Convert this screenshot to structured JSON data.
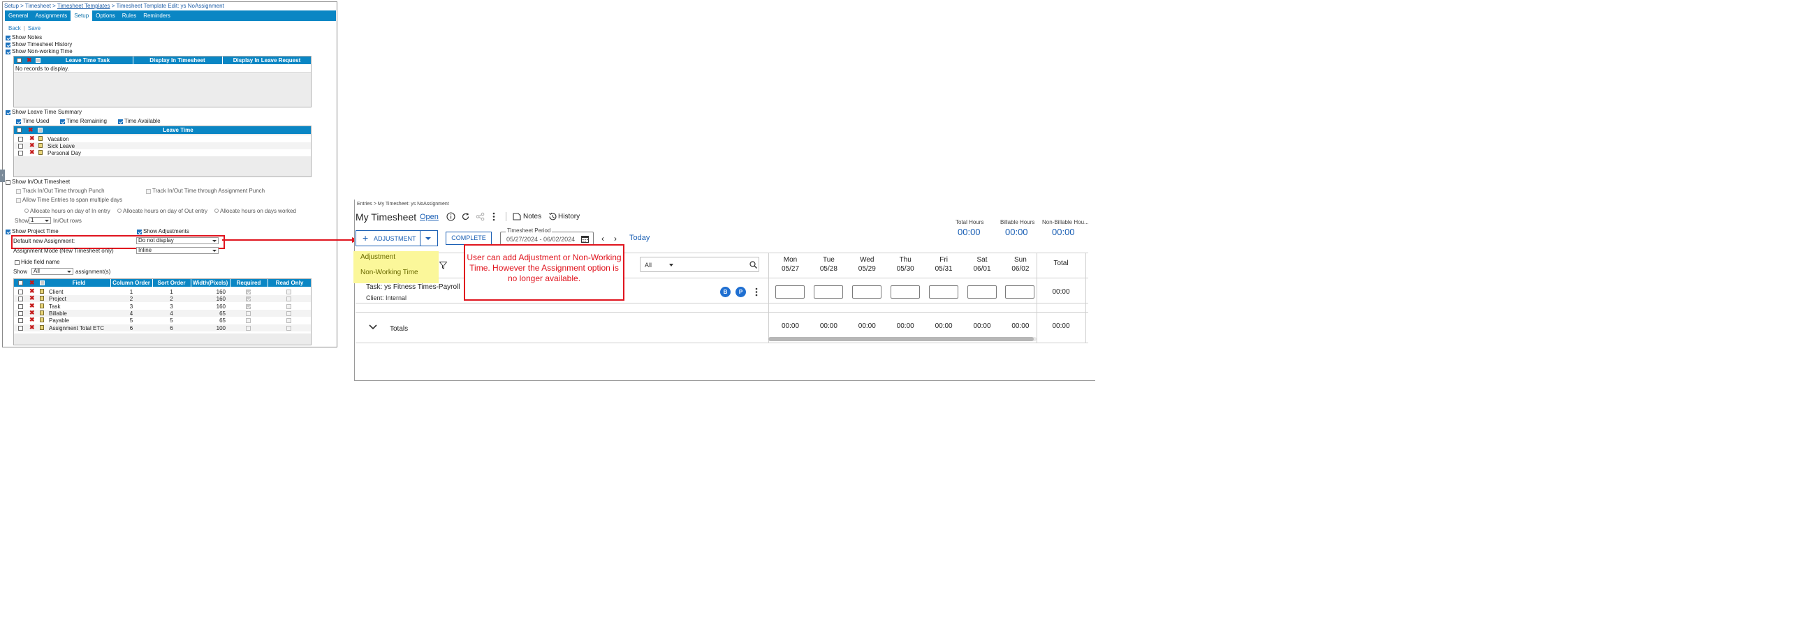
{
  "left": {
    "breadcrumb": {
      "p1": "Setup > Timesheet > ",
      "p2": "Timesheet Templates",
      "p3": " > Timesheet Template Edit: ys NoAssignment"
    },
    "tabs": [
      "General",
      "Assignments",
      "Setup",
      "Options",
      "Rules",
      "Reminders"
    ],
    "active_tab": "Setup",
    "back": "Back",
    "save": "Save",
    "show_notes": "Show Notes",
    "show_timesheet_history": "Show Timesheet History",
    "show_nonworking_time": "Show Non-working Time",
    "leave_grid": {
      "col1": "Leave Time Task",
      "col2": "Display In Timesheet",
      "col3": "Display In Leave Request",
      "empty": "No records to display."
    },
    "show_leave_summary": "Show Leave Time Summary",
    "time_used": "Time Used",
    "time_remaining": "Time Remaining",
    "time_available": "Time Available",
    "leave_time_grid": {
      "header": "Leave Time",
      "rows": [
        "Vacation",
        "Sick Leave",
        "Personal Day"
      ]
    },
    "show_inout": "Show In/Out Timesheet",
    "track_punch": "Track In/Out Time through Punch",
    "track_assignment_punch": "Track In/Out Time through Assignment Punch",
    "allow_span": "Allow Time Entries to span multiple days",
    "alloc_in": "Allocate hours on day of In entry",
    "alloc_out": "Allocate hours on day of Out entry",
    "alloc_worked": "Allocate hours on days worked",
    "show_label": "Show",
    "show_rows_value": "1",
    "inout_rows": "In/Out rows",
    "show_project_time": "Show Project Time",
    "show_adjustments": "Show Adjustments",
    "default_new_assignment_label": "Default new Assignment:",
    "default_new_assignment_value": "Do not display",
    "assignment_mode_label": "Assignment Mode (New Timesheet only)",
    "assignment_mode_value": "Inline",
    "hide_field_name": "Hide field name",
    "show_all_value": "All",
    "assignments_suffix": "assignment(s)",
    "field_grid": {
      "headers": [
        "Field",
        "Column Order",
        "Sort Order",
        "Width(Pixels)",
        "Required",
        "Read Only"
      ],
      "rows": [
        {
          "field": "Client",
          "col": "1",
          "sort": "1",
          "width": "160"
        },
        {
          "field": "Project",
          "col": "2",
          "sort": "2",
          "width": "160"
        },
        {
          "field": "Task",
          "col": "3",
          "sort": "3",
          "width": "160"
        },
        {
          "field": "Billable",
          "col": "4",
          "sort": "4",
          "width": "65"
        },
        {
          "field": "Payable",
          "col": "5",
          "sort": "5",
          "width": "65"
        },
        {
          "field": "Assignment Total ETC",
          "col": "6",
          "sort": "6",
          "width": "100"
        }
      ]
    }
  },
  "right": {
    "breadcrumb": "Entries > My Timesheet: ys NoAssignment",
    "title": "My Timesheet",
    "status": "Open",
    "notes": "Notes",
    "history": "History",
    "adjustment_btn": "ADJUSTMENT",
    "complete_btn": "COMPLETE",
    "period_label": "Timesheet Period",
    "period_value": "05/27/2024 - 06/02/2024",
    "today": "Today",
    "summary": [
      {
        "label": "Total Hours",
        "value": "00:00"
      },
      {
        "label": "Billable Hours",
        "value": "00:00"
      },
      {
        "label": "Non-Billable Hou...",
        "value": "00:00"
      }
    ],
    "dropdown_items": [
      "Adjustment",
      "Non-Working Time"
    ],
    "filter_value": "All",
    "days": [
      {
        "d": "Mon",
        "date": "05/27"
      },
      {
        "d": "Tue",
        "date": "05/28"
      },
      {
        "d": "Wed",
        "date": "05/29"
      },
      {
        "d": "Thu",
        "date": "05/30"
      },
      {
        "d": "Fri",
        "date": "05/31"
      },
      {
        "d": "Sat",
        "date": "06/01"
      },
      {
        "d": "Sun",
        "date": "06/02"
      }
    ],
    "total_label": "Total",
    "task_name": "Task: ys Fitness Times-Payroll",
    "client": "Client: Internal",
    "badge_b": "B",
    "badge_p": "P",
    "row_total": "00:00",
    "totals_label": "Totals",
    "day_totals": [
      "00:00",
      "00:00",
      "00:00",
      "00:00",
      "00:00",
      "00:00",
      "00:00"
    ],
    "grand_total": "00:00"
  },
  "callout": "User can add Adjustment or Non-Working Time. However the Assignment option is no longer available.",
  "colors": {
    "accent": "#0a86c4",
    "link": "#1a5fb4",
    "annotation": "#e0141e",
    "dropdown": "#fbf79a"
  }
}
